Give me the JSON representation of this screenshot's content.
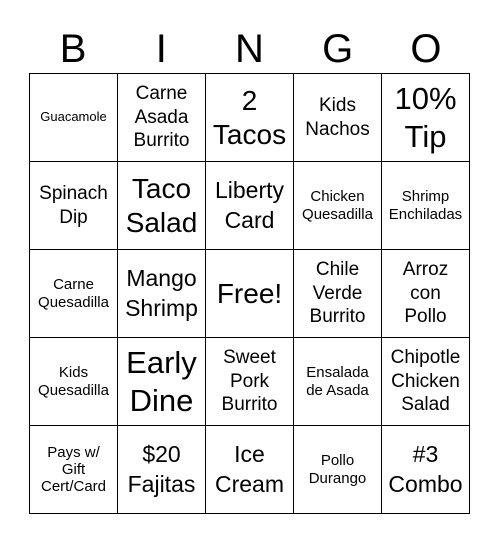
{
  "header": {
    "letters": [
      "B",
      "I",
      "N",
      "G",
      "O"
    ]
  },
  "board": {
    "rows": [
      [
        "Guacamole",
        "Carne\nAsada\nBurrito",
        "2\nTacos",
        "Kids\nNachos",
        "10%\nTip"
      ],
      [
        "Spinach\nDip",
        "Taco\nSalad",
        "Liberty\nCard",
        "Chicken\nQuesadilla",
        "Shrimp\nEnchiladas"
      ],
      [
        "Carne\nQuesadilla",
        "Mango\nShrimp",
        "Free!",
        "Chile\nVerde\nBurrito",
        "Arroz\ncon\nPollo"
      ],
      [
        "Kids\nQuesadilla",
        "Early\nDine",
        "Sweet\nPork\nBurrito",
        "Ensalada\nde Asada",
        "Chipotle\nChicken\nSalad"
      ],
      [
        "Pays w/\nGift\nCert/Card",
        "$20\nFajitas",
        "Ice\nCream",
        "Pollo\nDurango",
        "#3\nCombo"
      ]
    ],
    "free_space": "Free!"
  }
}
